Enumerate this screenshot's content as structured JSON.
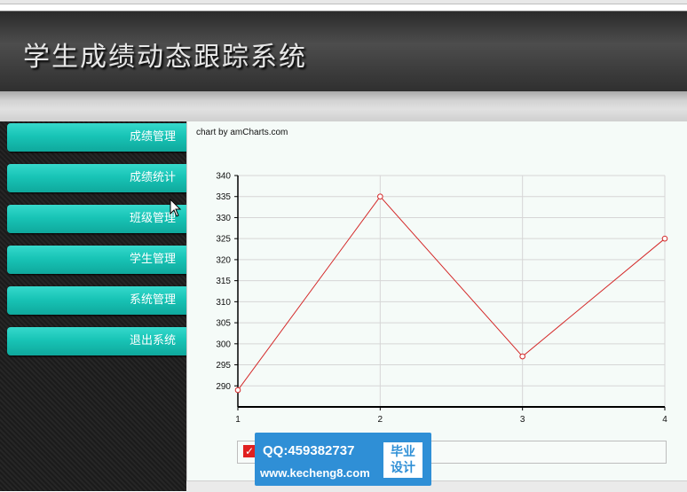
{
  "header": {
    "title": "学生成绩动态跟踪系统"
  },
  "sidebar": {
    "items": [
      {
        "label": "成绩管理"
      },
      {
        "label": "成绩统计"
      },
      {
        "label": "班级管理"
      },
      {
        "label": "学生管理"
      },
      {
        "label": "系统管理"
      },
      {
        "label": "退出系统"
      }
    ]
  },
  "credit": "chart by amCharts.com",
  "chart_data": {
    "type": "line",
    "x": [
      1,
      2,
      3,
      4
    ],
    "values": [
      289,
      335,
      297,
      325
    ],
    "ylim": [
      285,
      340
    ],
    "yticks": [
      290,
      295,
      300,
      305,
      310,
      315,
      320,
      325,
      330,
      335,
      340
    ],
    "xticks": [
      1,
      2,
      3,
      4
    ],
    "grid": true,
    "line_color": "#d42a2a",
    "legend": "bottom"
  },
  "watermark": {
    "qq": "QQ:459382737",
    "url": "www.kecheng8.com",
    "badge_line1": "毕业",
    "badge_line2": "设计"
  },
  "colors": {
    "menu": "#18c4b6",
    "header": "#3e3e3e"
  }
}
